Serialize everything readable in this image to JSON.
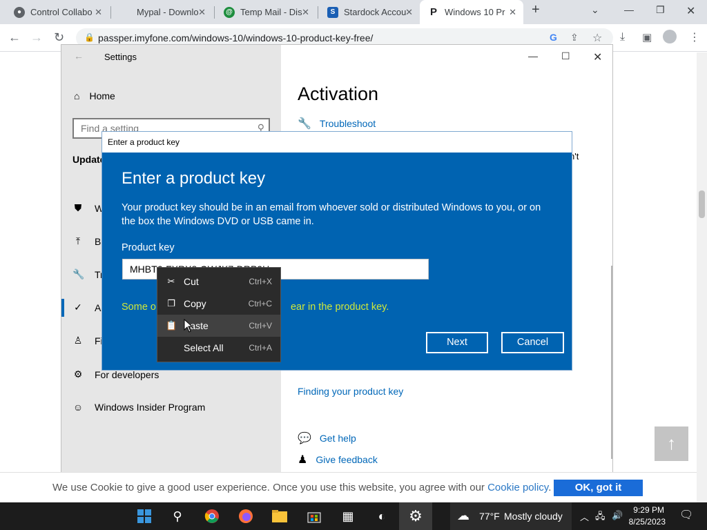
{
  "browser": {
    "tabs": [
      {
        "title": "Control Collabo",
        "icon": "steam-icon"
      },
      {
        "title": "Mypal - Downlo",
        "icon": "blank-icon"
      },
      {
        "title": "Temp Mail - Dis",
        "icon": "tempmail-icon"
      },
      {
        "title": "Stardock Accou",
        "icon": "stardock-icon"
      },
      {
        "title": "Windows 10 Pr",
        "icon": "passper-icon"
      }
    ],
    "url": "passper.imyfone.com/windows-10/windows-10-product-key-free/"
  },
  "settings": {
    "title": "Settings",
    "home_label": "Home",
    "search_placeholder": "Find a setting",
    "section_title": "Update",
    "nav_items": [
      {
        "label": "W",
        "icon": "shield-icon"
      },
      {
        "label": "Ba",
        "icon": "backup-icon"
      },
      {
        "label": "Tr",
        "icon": "wrench-icon"
      },
      {
        "label": "Ac",
        "icon": "check-circle-icon"
      },
      {
        "label": "Fi",
        "icon": "person-icon"
      },
      {
        "label": "For developers",
        "icon": "developer-icon"
      },
      {
        "label": "Windows Insider Program",
        "icon": "insider-cat-icon"
      }
    ],
    "right": {
      "title": "Activation",
      "troubleshoot": "Troubleshoot",
      "fragment_1": "n't",
      "fragment_2": "l",
      "finding_key": "Finding your product key",
      "get_help": "Get help",
      "give_feedback": "Give feedback"
    }
  },
  "dialog": {
    "titlebar": "Enter a product key",
    "heading": "Enter a product key",
    "description": "Your product key should be in an email from whoever sold or distributed Windows to you, or on the box the Windows DVD or USB came in.",
    "label": "Product key",
    "value": "MHBT6-FXRX8-QWJK7-DRP9H",
    "warning_start": "Some o",
    "warning_end": "ear in the product key.",
    "next_label": "Next",
    "cancel_label": "Cancel"
  },
  "context_menu": {
    "items": [
      {
        "label": "Cut",
        "shortcut": "Ctrl+X",
        "icon": "scissors-icon"
      },
      {
        "label": "Copy",
        "shortcut": "Ctrl+C",
        "icon": "copy-icon"
      },
      {
        "label": "Paste",
        "shortcut": "Ctrl+V",
        "icon": "paste-icon"
      },
      {
        "label": "Select All",
        "shortcut": "Ctrl+A",
        "icon": ""
      }
    ]
  },
  "cookie": {
    "text": "We use Cookie to give a good user experience. Once you use this website, you agree with our ",
    "link": "Cookie policy",
    "period": ".",
    "button": "OK, got it"
  },
  "taskbar": {
    "weather_temp": "77°F",
    "weather_desc": "Mostly cloudy",
    "time": "9:29 PM",
    "date": "8/25/2023"
  },
  "colors": {
    "dialog_blue": "#0063b1",
    "warning_yellow": "#cfe83a",
    "link_blue": "#0067b8",
    "taskbar": "#1c1c1c"
  }
}
